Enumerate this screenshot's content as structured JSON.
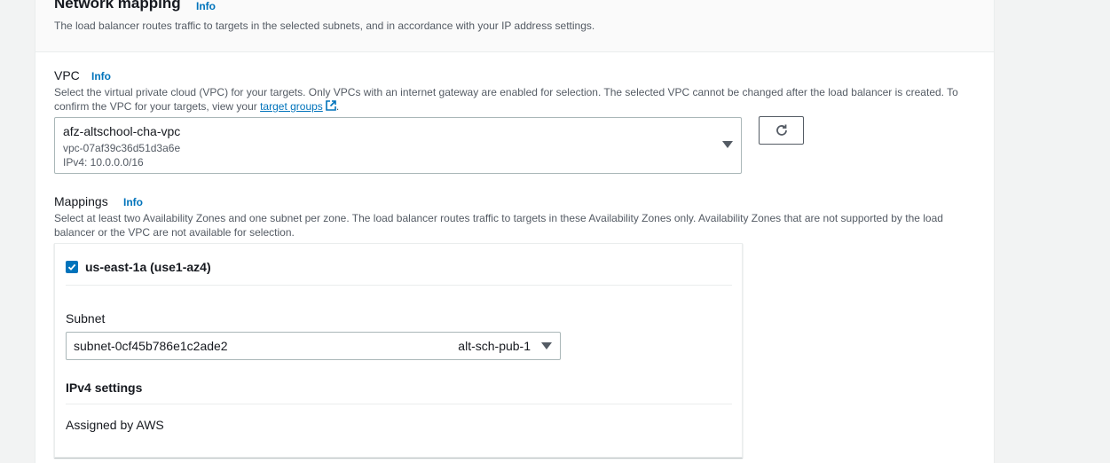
{
  "header": {
    "title": "Network mapping",
    "info": "Info",
    "description": "The load balancer routes traffic to targets in the selected subnets, and in accordance with your IP address settings."
  },
  "vpc": {
    "label": "VPC",
    "info": "Info",
    "description_line1": "Select the virtual private cloud (VPC) for your targets. Only VPCs with an internet gateway are enabled for selection. The selected VPC cannot be changed after the load balancer is created. To",
    "description_line2_prefix": "confirm the VPC for your targets, view your ",
    "description_link": "target groups",
    "description_suffix": ".",
    "selected": {
      "name": "afz-altschool-cha-vpc",
      "id": "vpc-07af39c36d51d3a6e",
      "ipv4": "IPv4: 10.0.0.0/16"
    },
    "refresh_icon": "refresh-icon"
  },
  "mappings": {
    "label": "Mappings",
    "info": "Info",
    "description_line1": "Select at least two Availability Zones and one subnet per zone. The load balancer routes traffic to targets in these Availability Zones only. Availability Zones that are not supported by the load",
    "description_line2": "balancer or the VPC are not available for selection.",
    "zone": {
      "checked": true,
      "label": "us-east-1a (use1-az4)",
      "subnet_label": "Subnet",
      "subnet_id": "subnet-0cf45b786e1c2ade2",
      "subnet_name": "alt-sch-pub-1",
      "ipv4_settings_label": "IPv4 settings",
      "ipv4_assignment": "Assigned by AWS"
    }
  },
  "colors": {
    "link": "#0073bb",
    "text": "#16191f",
    "muted": "#545b64",
    "border": "#aab7b8"
  }
}
